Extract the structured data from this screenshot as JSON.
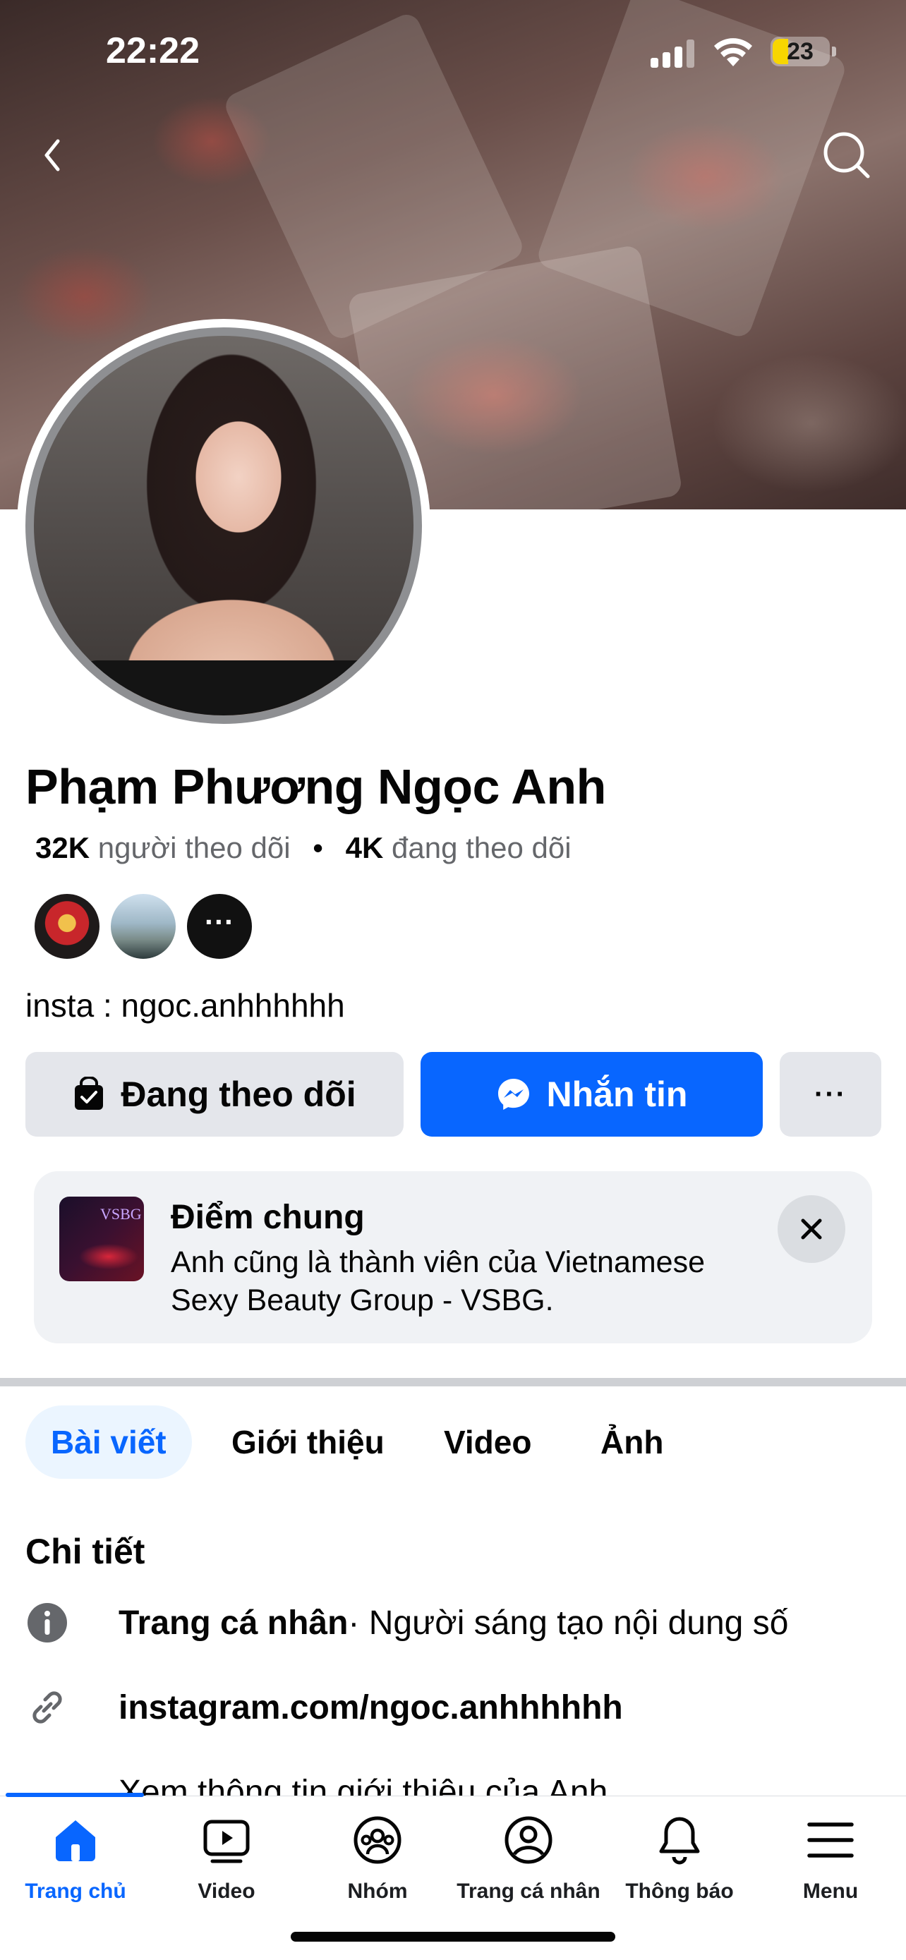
{
  "status_bar": {
    "time": "22:22",
    "battery": "23"
  },
  "profile": {
    "name": "Phạm Phương Ngọc Anh",
    "followers_count": "32K",
    "followers_label": "người theo dõi",
    "following_count": "4K",
    "following_label": "đang theo dõi",
    "bio": "insta : ngoc.anhhhhhh",
    "mutual_more": "···"
  },
  "actions": {
    "following_label": "Đang theo dõi",
    "message_label": "Nhắn tin",
    "more_label": "···"
  },
  "mutual": {
    "title": "Điểm chung",
    "description": "Anh cũng là thành viên của Vietnamese Sexy Beauty Group - VSBG.",
    "thumb_text": "VSBG"
  },
  "tabs": [
    {
      "label": "Bài viết",
      "active": true
    },
    {
      "label": "Giới thiệu",
      "active": false
    },
    {
      "label": "Video",
      "active": false
    },
    {
      "label": "Ảnh",
      "active": false
    }
  ],
  "details": {
    "title": "Chi tiết",
    "page_type_bold": "Trang cá nhân",
    "page_type_rest": " · Người sáng tạo nội dung số",
    "link": "instagram.com/ngoc.anhhhhhh",
    "about_link": "Xem thông tin giới thiệu của Anh"
  },
  "bottom_nav": [
    {
      "label": "Trang chủ",
      "icon": "home-icon",
      "active": true
    },
    {
      "label": "Video",
      "icon": "video-icon",
      "active": false
    },
    {
      "label": "Nhóm",
      "icon": "groups-icon",
      "active": false
    },
    {
      "label": "Trang cá nhân",
      "icon": "profile-icon",
      "active": false
    },
    {
      "label": "Thông báo",
      "icon": "bell-icon",
      "active": false
    },
    {
      "label": "Menu",
      "icon": "menu-icon",
      "active": false
    }
  ],
  "colors": {
    "accent": "#0866ff",
    "button_gray": "#e4e6eb",
    "card_bg": "#f0f2f5"
  }
}
